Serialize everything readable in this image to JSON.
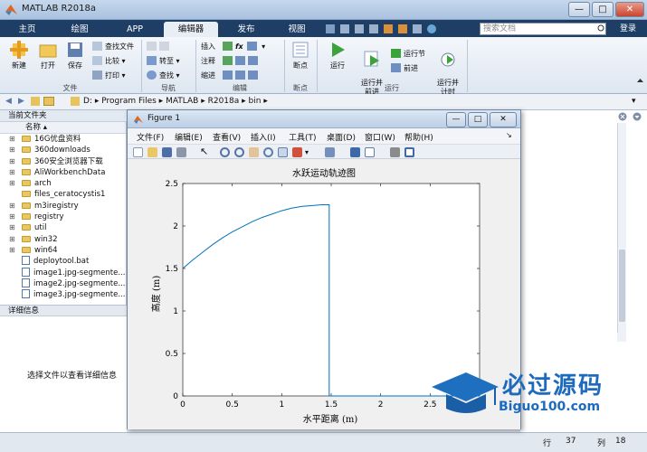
{
  "app": {
    "title": "MATLAB R2018a",
    "window_buttons": {
      "minimize": "—",
      "maximize": "□",
      "close": "✕"
    }
  },
  "tabs": [
    {
      "label": "主页"
    },
    {
      "label": "绘图"
    },
    {
      "label": "APP"
    },
    {
      "label": "编辑器",
      "active": true
    },
    {
      "label": "发布"
    },
    {
      "label": "视图"
    }
  ],
  "search": {
    "placeholder": "搜索文档"
  },
  "login_label": "登录",
  "ribbon": {
    "groups": [
      "文件",
      "导航",
      "编辑",
      "断点",
      "运行"
    ],
    "file": {
      "new": "新建",
      "open": "打开",
      "save": "保存",
      "find_files": "查找文件",
      "compare": "比较",
      "print": "打印"
    },
    "navigate": {
      "goto": "转至",
      "find": "查找"
    },
    "edit": {
      "insert": "插入",
      "comment": "注释",
      "indent": "缩进",
      "fx": "fx"
    },
    "breakpoints": {
      "label": "断点"
    },
    "run": {
      "run": "运行",
      "run_advance": "运行并\n前进",
      "run_section": "运行节",
      "advance": "前进",
      "run_time": "运行并\n计时"
    }
  },
  "address": {
    "path": [
      "D:",
      "Program Files",
      "MATLAB",
      "R2018a",
      "bin"
    ]
  },
  "current_folder": {
    "title": "当前文件夹",
    "column": "名称",
    "items": [
      {
        "name": "16G优盘资料",
        "type": "folder"
      },
      {
        "name": "360downloads",
        "type": "folder"
      },
      {
        "name": "360安全浏览器下载",
        "type": "folder"
      },
      {
        "name": "AliWorkbenchData",
        "type": "folder"
      },
      {
        "name": "arch",
        "type": "folder"
      },
      {
        "name": "files_ceratocystis1",
        "type": "folder"
      },
      {
        "name": "m3iregistry",
        "type": "folder"
      },
      {
        "name": "registry",
        "type": "folder"
      },
      {
        "name": "util",
        "type": "folder"
      },
      {
        "name": "win32",
        "type": "folder"
      },
      {
        "name": "win64",
        "type": "folder"
      },
      {
        "name": "deploytool.bat",
        "type": "file"
      },
      {
        "name": "image1.jpg-segmente...",
        "type": "file"
      },
      {
        "name": "image2.jpg-segmente...",
        "type": "file"
      },
      {
        "name": "image3.jpg-segmente...",
        "type": "file"
      }
    ]
  },
  "details": {
    "title": "详细信息",
    "message": "选择文件以查看详细信息"
  },
  "status": {
    "row_label": "行",
    "row": "37",
    "col_label": "列",
    "col": "18"
  },
  "figure": {
    "title": "Figure 1",
    "menu": [
      "文件(F)",
      "编辑(E)",
      "查看(V)",
      "插入(I)",
      "工具(T)",
      "桌面(D)",
      "窗口(W)",
      "帮助(H)"
    ]
  },
  "chart_data": {
    "type": "line",
    "title": "水跃运动轨迹图",
    "xlabel": "水平距离 (m)",
    "ylabel": "高度 (m)",
    "xlim": [
      0,
      3
    ],
    "ylim": [
      0,
      2.5
    ],
    "xticks": [
      "0",
      "0.5",
      "1",
      "1.5",
      "2",
      "2.5"
    ],
    "yticks": [
      "0",
      "0.5",
      "1",
      "1.5",
      "2",
      "2.5"
    ],
    "series": [
      {
        "color": "#0072bd",
        "x": [
          0,
          0.1,
          0.2,
          0.3,
          0.4,
          0.5,
          0.6,
          0.7,
          0.8,
          0.9,
          1.0,
          1.1,
          1.2,
          1.3,
          1.4,
          1.48,
          1.48,
          1.5,
          2.0,
          2.5,
          3.0
        ],
        "y": [
          1.5,
          1.6,
          1.69,
          1.78,
          1.86,
          1.93,
          1.99,
          2.05,
          2.1,
          2.14,
          2.18,
          2.21,
          2.23,
          2.24,
          2.25,
          2.25,
          0,
          0,
          0,
          0,
          0
        ]
      }
    ],
    "grid": false
  },
  "watermark": {
    "brand": "必过源码",
    "site": "Biguo100.com"
  }
}
